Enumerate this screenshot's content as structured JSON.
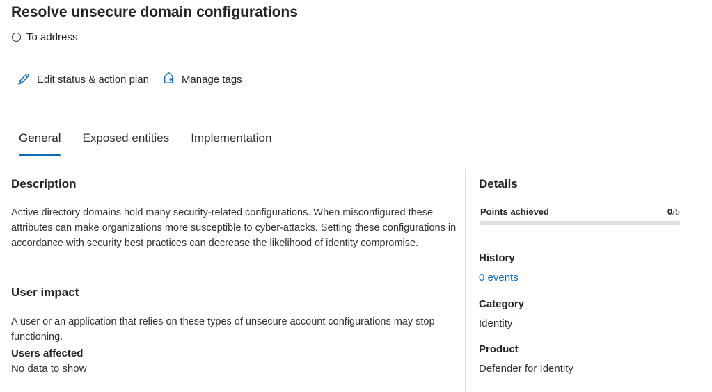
{
  "page": {
    "title": "Resolve unsecure domain configurations",
    "status": "To address"
  },
  "actions": {
    "edit_label": "Edit status & action plan",
    "tags_label": "Manage tags"
  },
  "tabs": [
    {
      "label": "General",
      "active": true
    },
    {
      "label": "Exposed entities",
      "active": false
    },
    {
      "label": "Implementation",
      "active": false
    }
  ],
  "description": {
    "title": "Description",
    "text": "Active directory domains hold many security-related configurations. When misconfigured these attributes can make organizations more susceptible to cyber-attacks. Setting these configurations in accordance with security best practices can decrease the likelihood of identity compromise."
  },
  "user_impact": {
    "title": "User impact",
    "text": "A user or an application that relies on these types of unsecure account configurations may stop functioning.",
    "users_affected_label": "Users affected",
    "users_affected_value": "No data to show"
  },
  "details": {
    "title": "Details",
    "points_label": "Points achieved",
    "points_achieved": "0",
    "points_max": "/5",
    "points_fraction": 0,
    "history_label": "History",
    "history_value": "0 events",
    "category_label": "Category",
    "category_value": "Identity",
    "product_label": "Product",
    "product_value": "Defender for Identity"
  },
  "colors": {
    "accent": "#0f6cbd",
    "track": "#e1dfdd",
    "text": "#242424"
  }
}
